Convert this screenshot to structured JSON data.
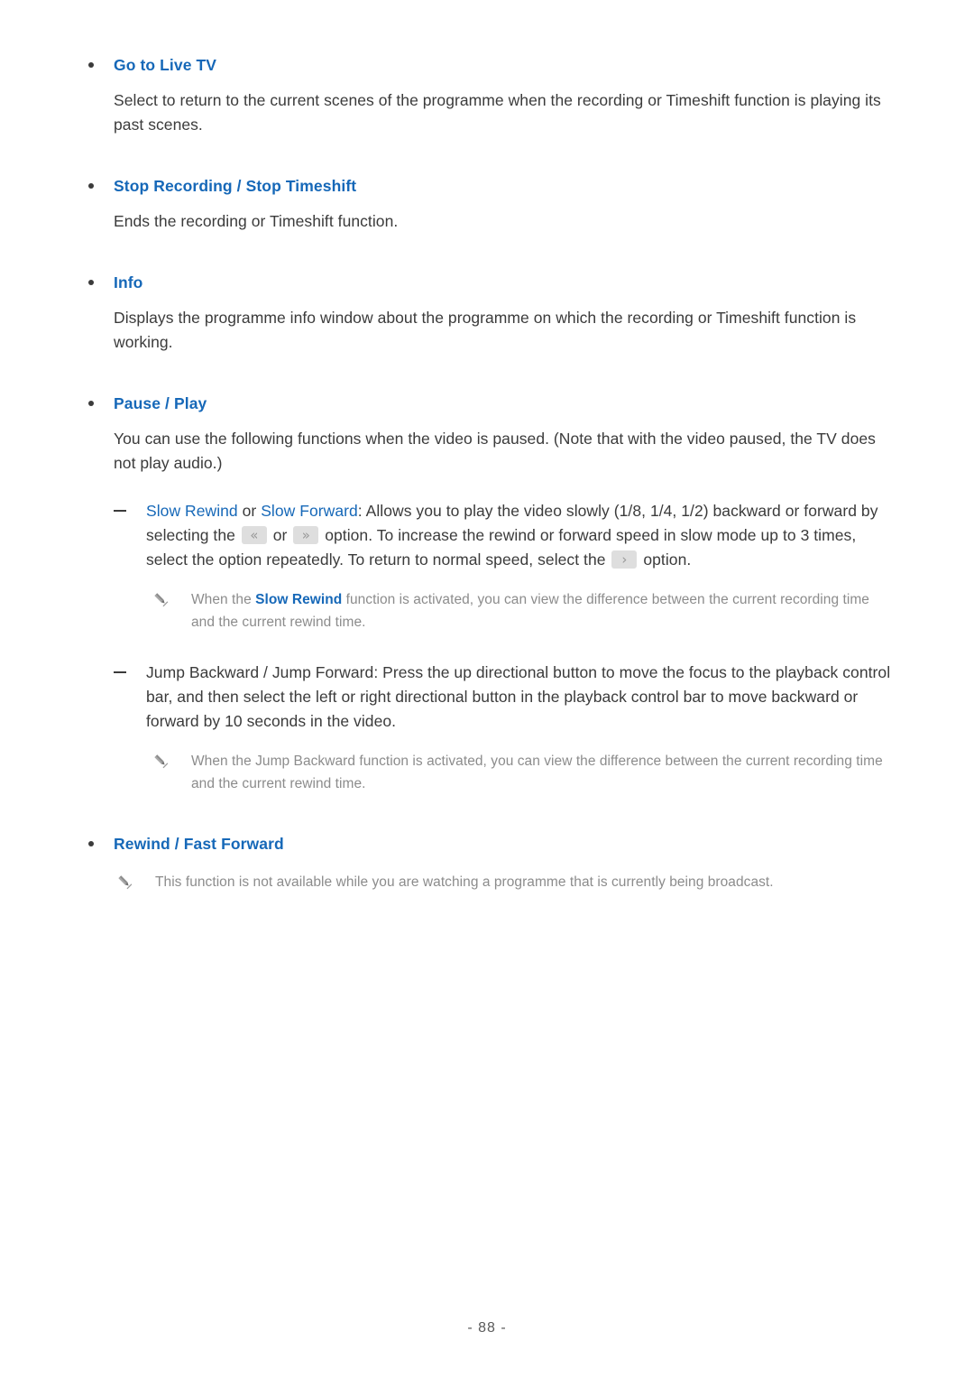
{
  "document": {
    "page_number": "- 88 -"
  },
  "sections": [
    {
      "title_main": "Go to Live TV",
      "body": "Select to return to the current scenes of the programme when the recording or Timeshift function is playing its past scenes."
    },
    {
      "title_main": "Stop Recording",
      "title_sep": " / ",
      "title_alt": "Stop Timeshift",
      "body": "Ends the recording or Timeshift function."
    },
    {
      "title_main": "Info",
      "body": "Displays the programme info window about the programme on which the recording or Timeshift function is working."
    },
    {
      "title_main": "Pause",
      "title_sep": " / ",
      "title_alt": "Play",
      "body": "You can use the following functions when the video is paused. (Note that with the video paused, the TV does not play audio.)"
    },
    {
      "title_main": "Rewind",
      "title_sep": " / ",
      "title_alt": "Fast Forward"
    }
  ],
  "sub_items": [
    {
      "term_a": "Slow Rewind",
      "term_joiner": " or ",
      "term_b": "Slow Forward",
      "text_1": ": Allows you to play the video slowly (1/8, 1/4, 1/2) backward or forward by selecting the ",
      "icon_rewind": "rewind-icon",
      "icon_rewind_glyph": "«",
      "text_2": " or ",
      "icon_forward": "fast-forward-icon",
      "icon_forward_glyph": "»",
      "text_3": " option. To increase the rewind or forward speed in slow mode up to 3 times, select the option repeatedly. To return to normal speed, select the ",
      "icon_play": "play-icon",
      "icon_play_glyph": "›",
      "text_4": " option."
    },
    {
      "text": "Jump Backward / Jump Forward: Press the up directional button to move the focus to the playback control bar, and then select the left or right directional button in the playback control bar to move backward or forward by 10 seconds in the video."
    }
  ],
  "notes": [
    {
      "icon": "pencil-icon",
      "text_before": "When the ",
      "highlight": "Slow Rewind",
      "text_after": " function is activated, you can view the difference between the current recording time and the current rewind time."
    },
    {
      "icon": "pencil-icon",
      "text": "When the Jump Backward function is activated, you can view the difference between the current recording time and the current rewind time."
    },
    {
      "icon": "pencil-icon",
      "text": "This function is not available while you are watching a programme that is currently being broadcast."
    }
  ],
  "colors": {
    "link_blue": "#1668b8",
    "body_text": "#3b3b3b",
    "note_gray": "#8c8c8c",
    "key_icon_bg": "#dedede"
  }
}
